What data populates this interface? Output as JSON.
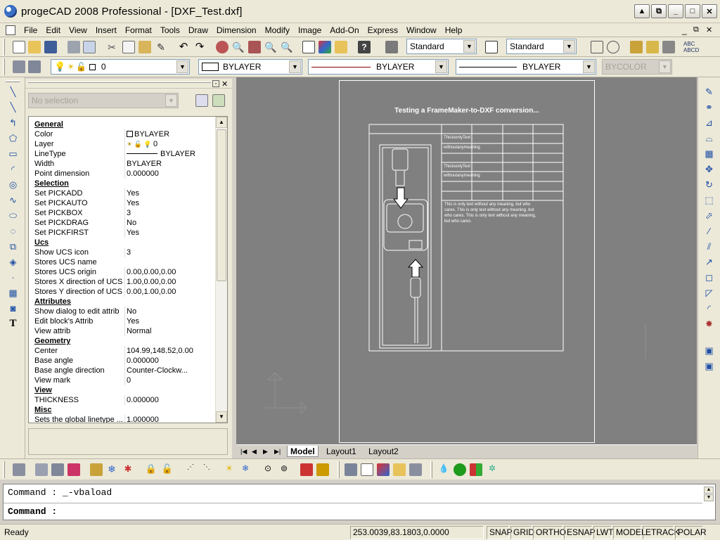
{
  "app": {
    "title": "progeCAD 2008 Professional - [DXF_Test.dxf]"
  },
  "menu": [
    "File",
    "Edit",
    "View",
    "Insert",
    "Format",
    "Tools",
    "Draw",
    "Dimension",
    "Modify",
    "Image",
    "Add-On",
    "Express",
    "Window",
    "Help"
  ],
  "toolbar": {
    "text_style": "Standard",
    "dim_style": "Standard",
    "layer_value": "0",
    "color": "BYLAYER",
    "linetype": "BYLAYER",
    "lineweight": "BYLAYER",
    "plotstyle": "BYCOLOR"
  },
  "properties": {
    "selection": "No selection",
    "rows": [
      {
        "k": "General",
        "v": "",
        "cat": true
      },
      {
        "k": "Color",
        "v": "BYLAYER"
      },
      {
        "k": "Layer",
        "v": "0"
      },
      {
        "k": "LineType",
        "v": "BYLAYER"
      },
      {
        "k": "Width",
        "v": "BYLAYER"
      },
      {
        "k": "Point dimension",
        "v": "0.000000"
      },
      {
        "k": "Selection",
        "v": "",
        "cat": true
      },
      {
        "k": "Set PICKADD",
        "v": "Yes"
      },
      {
        "k": "Set PICKAUTO",
        "v": "Yes"
      },
      {
        "k": "Set PICKBOX",
        "v": "3"
      },
      {
        "k": "Set PICKDRAG",
        "v": "No"
      },
      {
        "k": "Set PICKFIRST",
        "v": "Yes"
      },
      {
        "k": "Ucs",
        "v": "",
        "cat": true
      },
      {
        "k": "Show UCS icon",
        "v": "3"
      },
      {
        "k": "Stores UCS name",
        "v": ""
      },
      {
        "k": "Stores UCS origin",
        "v": "0.00,0.00,0.00"
      },
      {
        "k": "Stores X direction of UCS",
        "v": "1.00,0.00,0.00"
      },
      {
        "k": "Stores Y direction of UCS",
        "v": "0.00,1.00,0.00"
      },
      {
        "k": "Attributes",
        "v": "",
        "cat": true
      },
      {
        "k": "Show dialog to edit attrib",
        "v": "No"
      },
      {
        "k": "Edit block's Attrib",
        "v": "Yes"
      },
      {
        "k": "View attrib",
        "v": "Normal"
      },
      {
        "k": "Geometry",
        "v": "",
        "cat": true
      },
      {
        "k": "Center",
        "v": "104.99,148.52,0.00"
      },
      {
        "k": "Base angle",
        "v": "0.000000"
      },
      {
        "k": "Base angle direction",
        "v": "Counter-Clockw..."
      },
      {
        "k": "View mark",
        "v": "0"
      },
      {
        "k": "View",
        "v": "",
        "cat": true
      },
      {
        "k": "THICKNESS",
        "v": "0.000000"
      },
      {
        "k": "Misc",
        "v": "",
        "cat": true
      },
      {
        "k": "Sets the global linetype ...",
        "v": "1.000000"
      }
    ]
  },
  "drawing": {
    "heading": "Testing a FrameMaker-to-DXF conversion...",
    "cell1": "ThisIsonlyText",
    "cell2": "withoutanymeaning",
    "cell3": "ThisIsonlyText",
    "cell4": "withoutanymeaning",
    "para": [
      "This is only text without   any meaning, but who",
      "cares. This is only text   without any meaning, but",
      "who cares. This is only   text without any meaning,",
      "but who cares."
    ]
  },
  "tabs": [
    "Model",
    "Layout1",
    "Layout2"
  ],
  "command": {
    "line1": "Command : _-vbaload",
    "line2": "Command :"
  },
  "status": {
    "ready": "Ready",
    "coords": "253.0039,83.1803,0.0000",
    "buttons": [
      "SNAP",
      "GRID",
      "ORTHO",
      "ESNAP",
      "LWT",
      "MODEL",
      "ETRACK",
      "POLAR"
    ]
  },
  "colors": {
    "canvas": "#808080",
    "chrome": "#ece9d8"
  }
}
